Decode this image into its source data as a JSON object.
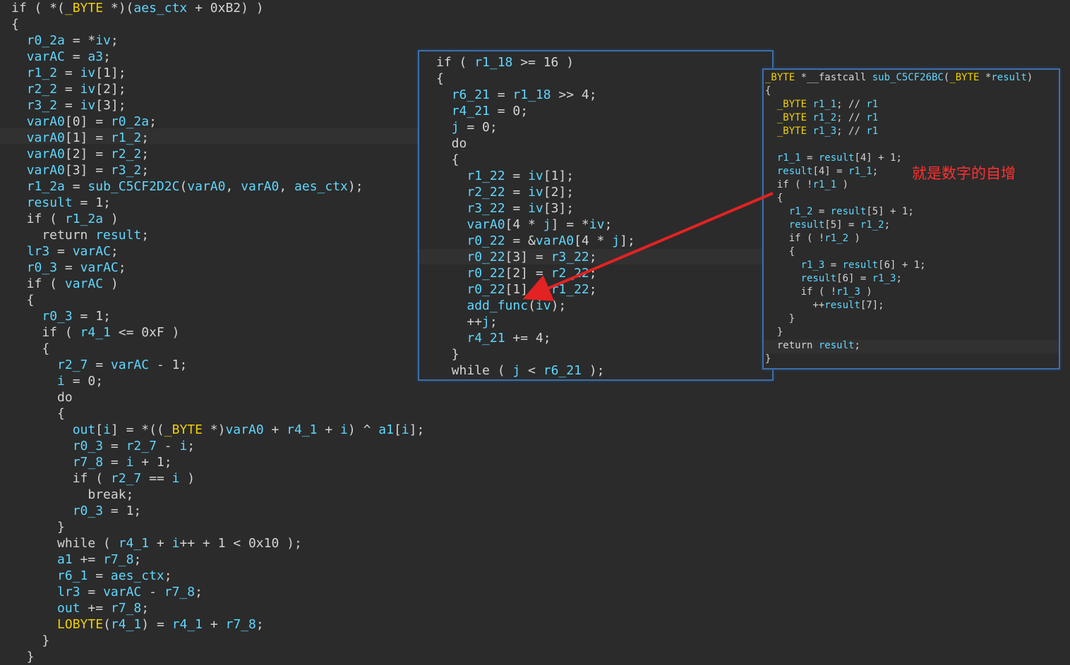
{
  "main": {
    "lines": [
      "if ( *(_BYTE *)(aes_ctx + 0xB2) )",
      "{",
      "  r0_2a = *iv;",
      "  varAC = a3;",
      "  r1_2 = iv[1];",
      "  r2_2 = iv[2];",
      "  r3_2 = iv[3];",
      "  varA0[0] = r0_2a;",
      "  varA0[1] = r1_2;",
      "  varA0[2] = r2_2;",
      "  varA0[3] = r3_2;",
      "  r1_2a = sub_C5CF2D2C(varA0, varA0, aes_ctx);",
      "  result = 1;",
      "  if ( r1_2a )",
      "    return result;",
      "  lr3 = varAC;",
      "  r0_3 = varAC;",
      "  if ( varAC )",
      "  {",
      "    r0_3 = 1;",
      "    if ( r4_1 <= 0xF )",
      "    {",
      "      r2_7 = varAC - 1;",
      "      i = 0;",
      "      do",
      "      {",
      "        out[i] = *((_BYTE *)varA0 + r4_1 + i) ^ a1[i];",
      "        r0_3 = r2_7 - i;",
      "        r7_8 = i + 1;",
      "        if ( r2_7 == i )",
      "          break;",
      "        r0_3 = 1;",
      "      }",
      "      while ( r4_1 + i++ + 1 < 0x10 );",
      "      a1 += r7_8;",
      "      r6_1 = aes_ctx;",
      "      lr3 = varAC - r7_8;",
      "      out += r7_8;",
      "      LOBYTE(r4_1) = r4_1 + r7_8;",
      "    }",
      "  }"
    ]
  },
  "mid_panel": {
    "lines": [
      "if ( r1_18 >= 16 )",
      "{",
      "  r6_21 = r1_18 >> 4;",
      "  r4_21 = 0;",
      "  j = 0;",
      "  do",
      "  {",
      "    r1_22 = iv[1];",
      "    r2_22 = iv[2];",
      "    r3_22 = iv[3];",
      "    varA0[4 * j] = *iv;",
      "    r0_22 = &varA0[4 * j];",
      "    r0_22[3] = r3_22;",
      "    r0_22[2] = r2_22;",
      "    r0_22[1] = r1_22;",
      "    add_func(iv);",
      "    ++j;",
      "    r4_21 += 4;",
      "  }",
      "  while ( j < r6_21 );"
    ]
  },
  "right_panel": {
    "signature": "_BYTE *__fastcall sub_C5CF26BC(_BYTE *result)",
    "lines": [
      "{",
      "  _BYTE r1_1; // r1",
      "  _BYTE r1_2; // r1",
      "  _BYTE r1_3; // r1",
      "",
      "  r1_1 = result[4] + 1;",
      "  result[4] = r1_1;",
      "  if ( !r1_1 )",
      "  {",
      "    r1_2 = result[5] + 1;",
      "    result[5] = r1_2;",
      "    if ( !r1_2 )",
      "    {",
      "      r1_3 = result[6] + 1;",
      "      result[6] = r1_3;",
      "      if ( !r1_3 )",
      "        ++result[7];",
      "    }",
      "  }",
      "  return result;",
      "}"
    ]
  },
  "annotation": {
    "text": "就是数字的自增",
    "color": "#ff3030"
  }
}
